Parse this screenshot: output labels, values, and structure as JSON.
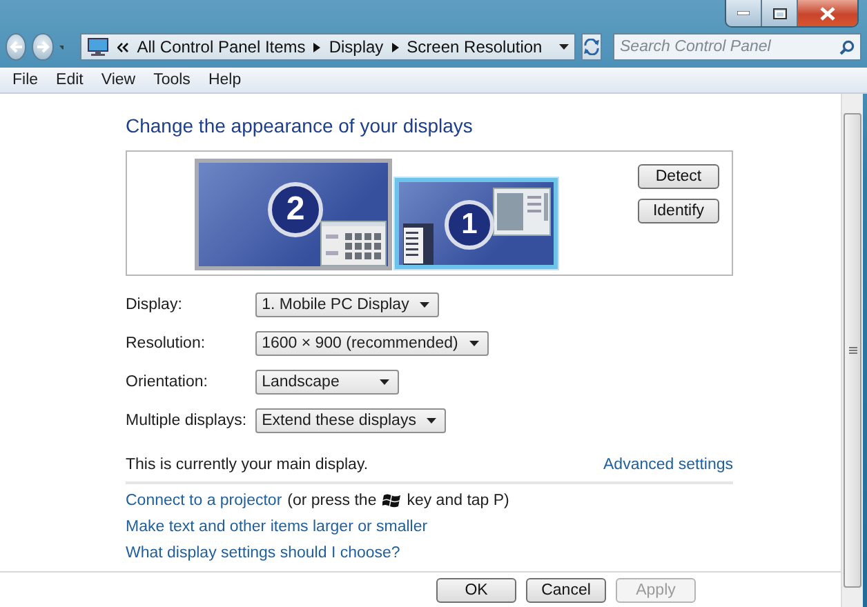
{
  "address_bar": {
    "crumbs": [
      "All Control Panel Items",
      "Display",
      "Screen Resolution"
    ]
  },
  "search": {
    "placeholder": "Search Control Panel"
  },
  "menu": [
    "File",
    "Edit",
    "View",
    "Tools",
    "Help"
  ],
  "heading": "Change the appearance of your displays",
  "monitors": [
    {
      "number": "2",
      "selected": false
    },
    {
      "number": "1",
      "selected": true
    }
  ],
  "monitor_buttons": [
    "Detect",
    "Identify"
  ],
  "settings": [
    {
      "label": "Display:",
      "value": "1. Mobile PC Display"
    },
    {
      "label": "Resolution:",
      "value": "1600 × 900 (recommended)"
    },
    {
      "label": "Orientation:",
      "value": "Landscape"
    },
    {
      "label": "Multiple displays:",
      "value": "Extend these displays"
    }
  ],
  "main_display_note": "This is currently your main display.",
  "advanced_link": "Advanced settings",
  "projector_hint": {
    "link": "Connect to a projector",
    "before_icon": "(or press the",
    "after_icon": "key and tap P)"
  },
  "links": [
    "Make text and other items larger or smaller",
    "What display settings should I choose?"
  ],
  "dialog_buttons": [
    {
      "label": "OK",
      "disabled": false
    },
    {
      "label": "Cancel",
      "disabled": false
    },
    {
      "label": "Apply",
      "disabled": true
    }
  ]
}
